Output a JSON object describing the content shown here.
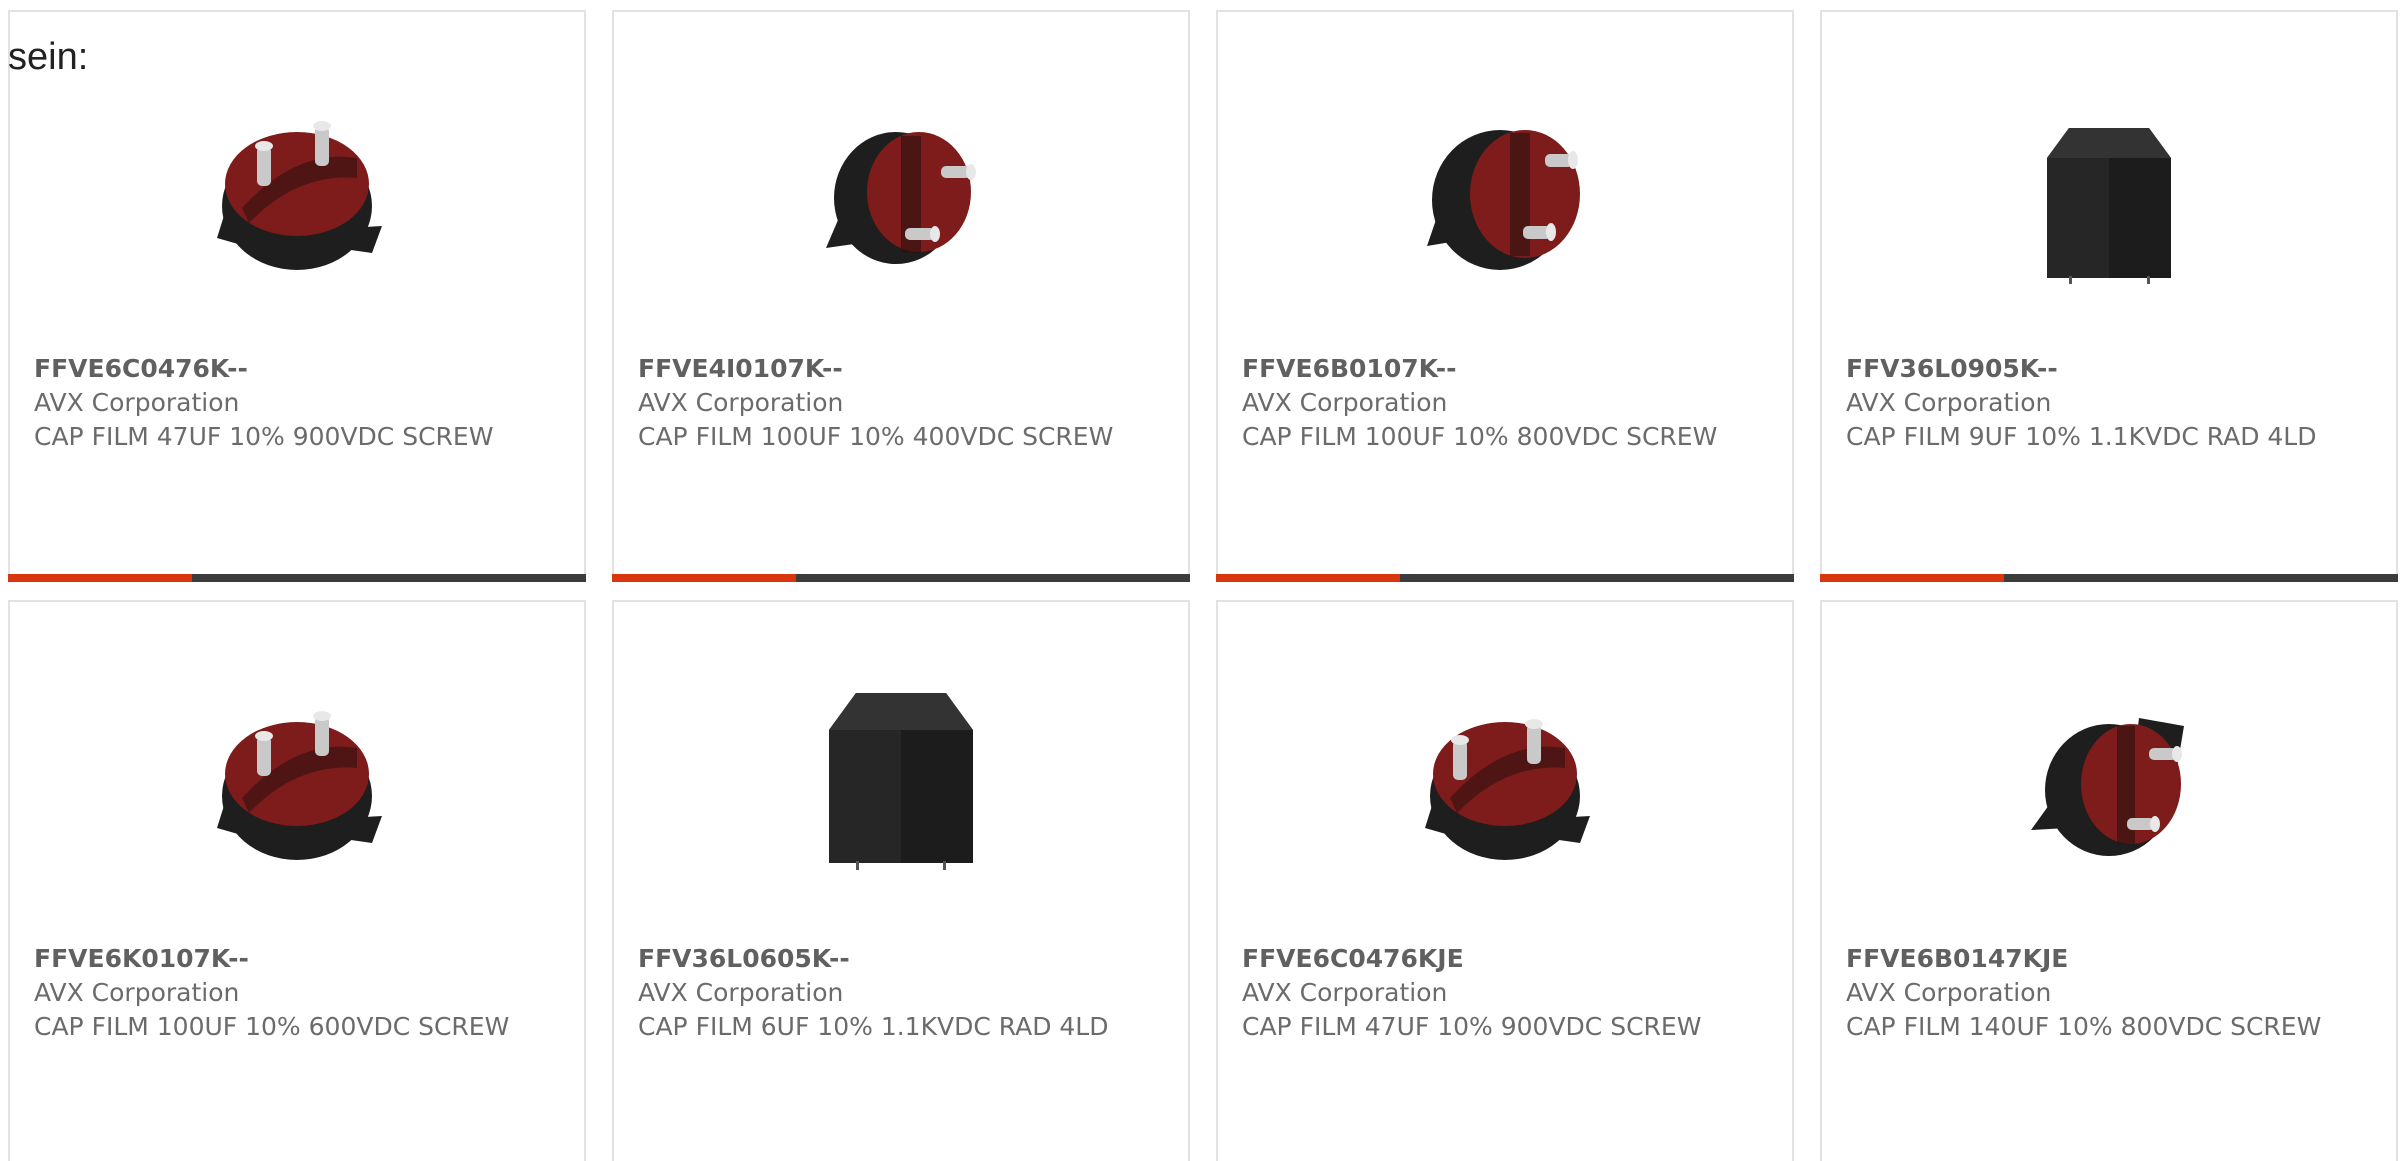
{
  "intro_text": "sein:",
  "colors": {
    "accent": "#d8360d",
    "bar_dark": "#3c3c3c",
    "card_border": "#e2e2e2",
    "text_gray": "#6b6b6b",
    "capacitor_red": "#8a1f1c",
    "capacitor_black": "#1e1e1e"
  },
  "products": [
    {
      "part_number": "FFVE6C0476K--",
      "manufacturer": "AVX Corporation",
      "description": "CAP FILM 47UF 10% 900VDC SCREW",
      "image_icon": "round-capacitor-icon"
    },
    {
      "part_number": "FFVE4I0107K--",
      "manufacturer": "AVX Corporation",
      "description": "CAP FILM 100UF 10% 400VDC SCREW",
      "image_icon": "round-capacitor-icon"
    },
    {
      "part_number": "FFVE6B0107K--",
      "manufacturer": "AVX Corporation",
      "description": "CAP FILM 100UF 10% 800VDC SCREW",
      "image_icon": "round-capacitor-icon"
    },
    {
      "part_number": "FFV36L0905K--",
      "manufacturer": "AVX Corporation",
      "description": "CAP FILM 9UF 10% 1.1KVDC RAD 4LD",
      "image_icon": "box-capacitor-icon"
    },
    {
      "part_number": "FFVE6K0107K--",
      "manufacturer": "AVX Corporation",
      "description": "CAP FILM 100UF 10% 600VDC SCREW",
      "image_icon": "round-capacitor-icon"
    },
    {
      "part_number": "FFV36L0605K--",
      "manufacturer": "AVX Corporation",
      "description": "CAP FILM 6UF 10% 1.1KVDC RAD 4LD",
      "image_icon": "box-capacitor-icon"
    },
    {
      "part_number": "FFVE6C0476KJE",
      "manufacturer": "AVX Corporation",
      "description": "CAP FILM 47UF 10% 900VDC SCREW",
      "image_icon": "round-capacitor-icon"
    },
    {
      "part_number": "FFVE6B0147KJE",
      "manufacturer": "AVX Corporation",
      "description": "CAP FILM 140UF 10% 800VDC SCREW",
      "image_icon": "round-capacitor-icon"
    }
  ]
}
